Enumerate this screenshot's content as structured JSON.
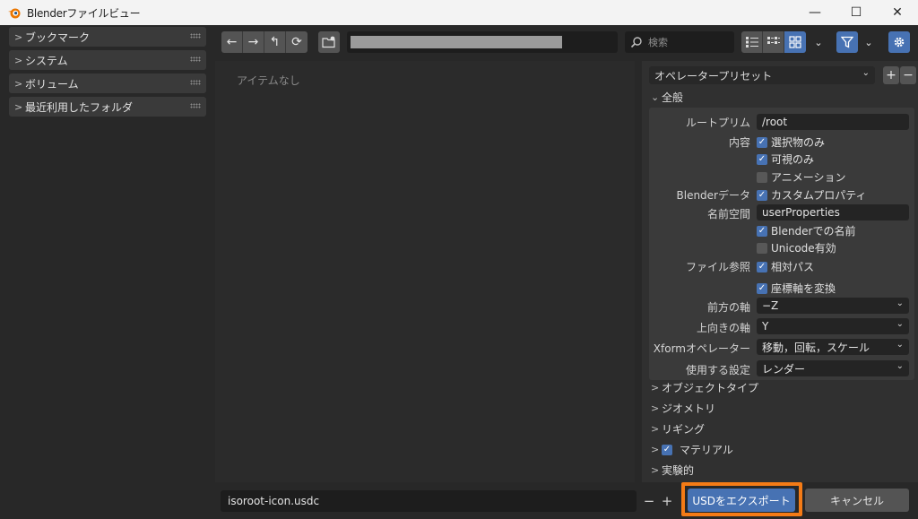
{
  "window": {
    "title": "Blenderファイルビュー",
    "minimize": "—",
    "maximize": "☐",
    "close": "✕"
  },
  "sidebar": {
    "panels": [
      {
        "label": "ブックマーク"
      },
      {
        "label": "システム"
      },
      {
        "label": "ボリューム"
      },
      {
        "label": "最近利用したフォルダ"
      }
    ]
  },
  "toolbar": {
    "back": "←",
    "forward": "→",
    "parent": "↰",
    "refresh": "⟳",
    "search_placeholder": "検索"
  },
  "file_list": {
    "empty_text": "アイテムなし"
  },
  "settings": {
    "preset_label": "オペレータープリセット",
    "preset_add": "+",
    "preset_remove": "−",
    "general_section": "全般",
    "root_prim_label": "ルートプリム",
    "root_prim_value": "/root",
    "content_label": "内容",
    "selected_only": {
      "label": "選択物のみ",
      "checked": true
    },
    "visible_only": {
      "label": "可視のみ",
      "checked": true
    },
    "animation": {
      "label": "アニメーション",
      "checked": false
    },
    "blender_data_label": "Blenderデータ",
    "custom_props": {
      "label": "カスタムプロパティ",
      "checked": true
    },
    "namespace_label": "名前空間",
    "namespace_value": "userProperties",
    "blender_names": {
      "label": "Blenderでの名前",
      "checked": true
    },
    "unicode": {
      "label": "Unicode有効",
      "checked": false
    },
    "file_ref_label": "ファイル参照",
    "relative_paths": {
      "label": "相対パス",
      "checked": true
    },
    "convert_axes": {
      "label": "座標軸を変換",
      "checked": true
    },
    "forward_axis_label": "前方の軸",
    "forward_axis_value": "−Z",
    "up_axis_label": "上向きの軸",
    "up_axis_value": "Y",
    "xform_label": "Xformオペレーター",
    "xform_value": "移動，回転，スケール",
    "use_settings_label": "使用する設定",
    "use_settings_value": "レンダー",
    "collapsed_sections": [
      {
        "label": "オブジェクトタイプ"
      },
      {
        "label": "ジオメトリ"
      },
      {
        "label": "リギング"
      },
      {
        "label": "マテリアル",
        "checked": true
      },
      {
        "label": "実験的"
      }
    ]
  },
  "bottom": {
    "filename": "isoroot-icon.usdc",
    "decrement": "−",
    "increment": "+",
    "export_label": "USDをエクスポート",
    "cancel_label": "キャンセル"
  },
  "colors": {
    "accent": "#4772b3",
    "highlight": "#f47b16"
  }
}
